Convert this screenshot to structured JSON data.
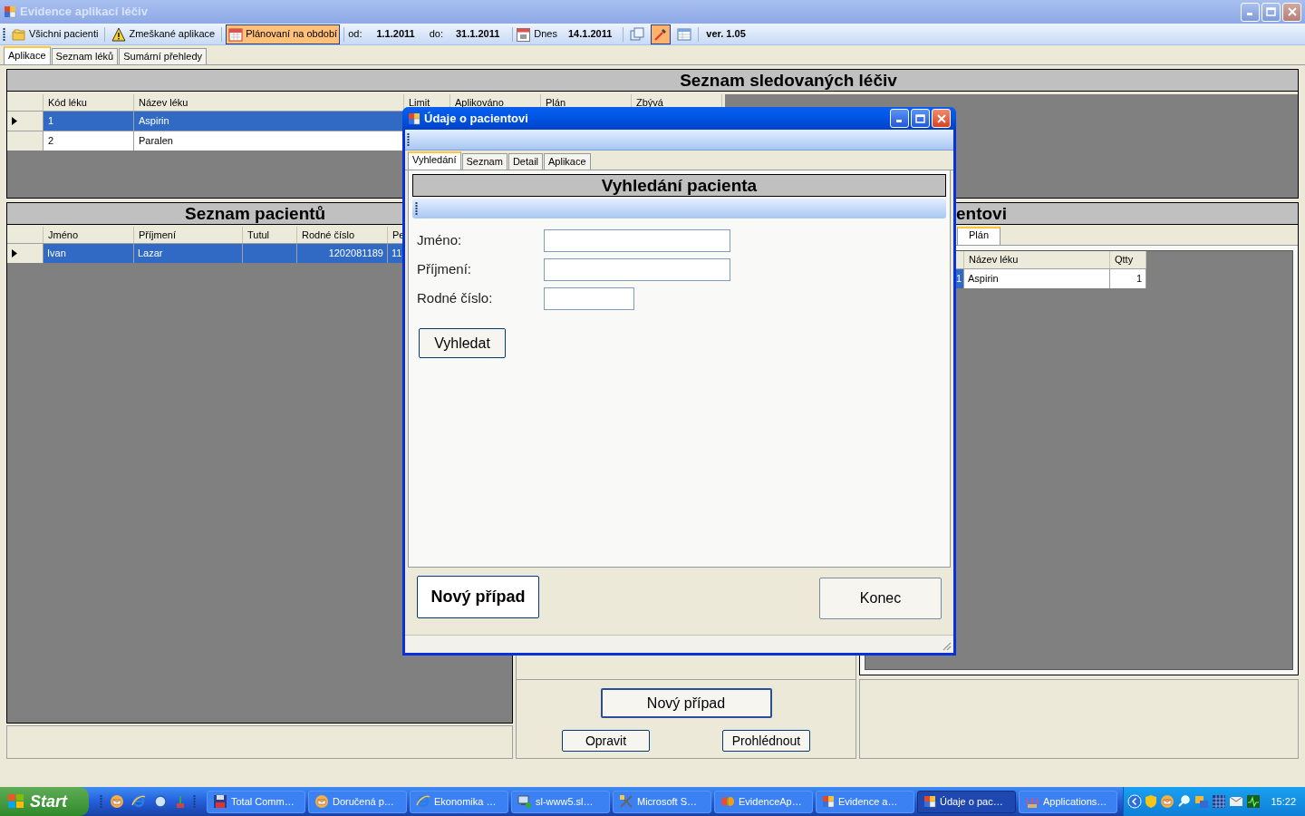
{
  "window": {
    "title": "Evidence aplikací léčiv"
  },
  "toolbar": {
    "buttons": [
      {
        "kind": "folders",
        "label": "Všichni pacienti",
        "selected": false
      },
      {
        "kind": "warning",
        "label": "Zmeškané aplikace",
        "selected": false
      },
      {
        "kind": "calendar",
        "label": "Plánovaní na období",
        "selected": true
      }
    ],
    "from_label": "od:",
    "from": "1.1.2011",
    "to_label": "do:",
    "to": "31.1.2011",
    "today_label": "Dnes",
    "today": "14.1.2011",
    "icon_buttons": [
      {
        "kind": "windows",
        "selected": false
      },
      {
        "kind": "pipette",
        "selected": true
      },
      {
        "kind": "table",
        "selected": false
      }
    ],
    "version": "ver. 1.05"
  },
  "tabs": [
    {
      "label": "Aplikace",
      "selected": true
    },
    {
      "label": "Seznam léků",
      "selected": false
    },
    {
      "label": "Sumární přehledy",
      "selected": false
    }
  ],
  "drugs_panel": {
    "title": "Seznam sledovaných léčiv",
    "columns": [
      "Kód léku",
      "Název léku",
      "Limit",
      "Aplikováno",
      "Plán",
      "Zbývá"
    ],
    "rows": [
      {
        "cells": [
          "1",
          "Aspirin"
        ],
        "selected": true
      },
      {
        "cells": [
          "2",
          "Paralen"
        ],
        "selected": false
      }
    ]
  },
  "patients_panel": {
    "title": "Seznam pacientů",
    "columns": [
      "Jméno",
      "Příjmení",
      "Tutul",
      "Rodné číslo",
      "Pe"
    ],
    "rows": [
      {
        "cells": [
          "Ivan",
          "Lazar",
          null,
          "1202081189",
          "11"
        ],
        "selected": true
      }
    ]
  },
  "middle_panel": {
    "new_case_button": "Nový případ",
    "edit_button": "Opravit",
    "view_button": "Prohlédnout"
  },
  "right_panel": {
    "title": "entovi",
    "tabs": [
      {
        "label": "Plán",
        "selected": true
      }
    ],
    "columns": [
      "Název léku",
      "Qtty"
    ],
    "rows": [
      {
        "row_header": "1",
        "cells": [
          "Aspirin",
          "1"
        ],
        "selected": true
      }
    ]
  },
  "dialog": {
    "title": "Údaje o pacientovi",
    "tabs": [
      {
        "label": "Vyhledání",
        "selected": true
      },
      {
        "label": "Seznam",
        "selected": false
      },
      {
        "label": "Detail",
        "selected": false
      },
      {
        "label": "Aplikace",
        "selected": false
      }
    ],
    "heading": "Vyhledání pacienta",
    "fields": [
      {
        "label": "Jméno:"
      },
      {
        "label": "Příjmení:"
      },
      {
        "label": "Rodné číslo:"
      }
    ],
    "search_button": "Vyhledat",
    "new_case_button": "Nový případ",
    "close_button": "Konec"
  },
  "taskbar": {
    "start": "Start",
    "tasks": [
      {
        "kind": "disk",
        "label": "Total Comm…",
        "selected": false
      },
      {
        "kind": "mail",
        "label": "Doručená p…",
        "selected": false
      },
      {
        "kind": "browser",
        "label": "Ekonomika …",
        "selected": false
      },
      {
        "kind": "remote",
        "label": "sl-www5.sl…",
        "selected": false
      },
      {
        "kind": "tools",
        "label": "Microsoft S…",
        "selected": false
      },
      {
        "kind": "butterfly",
        "label": "EvidenceAp…",
        "selected": false
      },
      {
        "kind": "app",
        "label": "Evidence a…",
        "selected": false
      },
      {
        "kind": "app",
        "label": "Údaje o pac…",
        "selected": true
      },
      {
        "kind": "brushes",
        "label": "Applications…",
        "selected": false
      }
    ],
    "clock": "15:22"
  }
}
